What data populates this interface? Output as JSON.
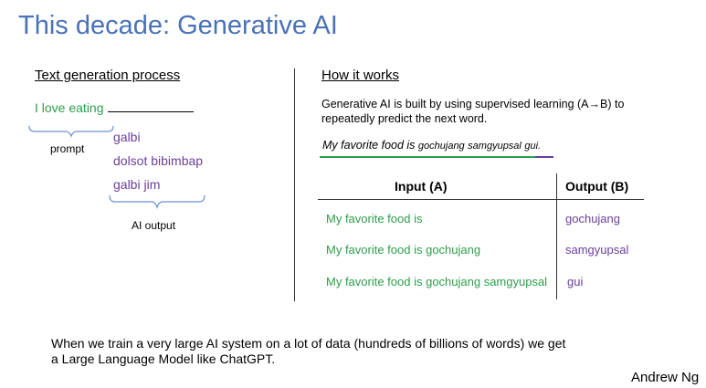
{
  "slide_title": "This decade: Generative AI",
  "left": {
    "heading": "Text generation process",
    "prompt_text": "I love eating",
    "blank": "_______________",
    "prompt_label": "prompt",
    "outputs": [
      "galbi",
      "dolsot bibimbap",
      "galbi jim"
    ],
    "output_label": "AI output"
  },
  "right": {
    "heading": "How it works",
    "desc_line1": "Generative AI is built by using supervised learning (A→B) to",
    "desc_line2": "repeatedly predict the next word.",
    "example_prefix": "My favorite food is ",
    "example_tokens": [
      "gochujang",
      "samgyupsal",
      "gui."
    ],
    "table": {
      "col_a": "Input (A)",
      "col_b": "Output (B)",
      "rows": [
        {
          "input": "My favorite food is",
          "output": "gochujang"
        },
        {
          "input": "My favorite food is gochujang",
          "output": "samgyupsal"
        },
        {
          "input": "My favorite food is gochujang samgyupsal",
          "output": "gui"
        }
      ]
    }
  },
  "footer_line1": "When we train a very large AI system on a lot of data (hundreds of billions of words) we get",
  "footer_line2": "a Large Language Model like ChatGPT.",
  "author": "Andrew Ng",
  "colors": {
    "title": "#4a72b8",
    "green": "#2e9e4a",
    "purple": "#6a3f9c"
  }
}
